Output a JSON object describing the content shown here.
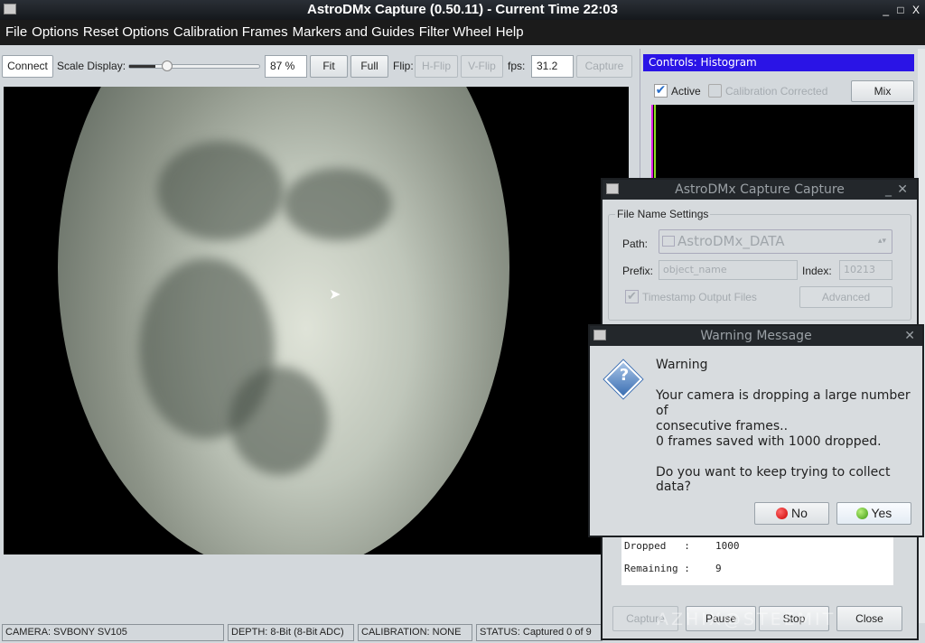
{
  "window": {
    "title": "AstroDMx Capture (0.50.11) - Current Time 22:03",
    "controls": [
      "_",
      "□",
      "X"
    ]
  },
  "menu": [
    "File",
    "Options",
    "Reset Options",
    "Calibration Frames",
    "Markers and Guides",
    "Filter Wheel",
    "Help"
  ],
  "toolbar": {
    "connect": "Connect",
    "scale_label": "Scale Display:",
    "scale_value": "87 %",
    "scale_fraction": 0.2,
    "fit": "Fit",
    "full": "Full",
    "flip_label": "Flip:",
    "hflip": "H-Flip",
    "vflip": "V-Flip",
    "fps_label": "fps:",
    "fps_value": "31.2",
    "capture": "Capture"
  },
  "histogram": {
    "title": "Controls: Histogram",
    "active": "Active",
    "active_checked": true,
    "calibration": "Calibration Corrected",
    "calibration_checked": false,
    "mix": "Mix",
    "accent": "#2a14e6"
  },
  "capture_dialog": {
    "title": "AstroDMx Capture Capture",
    "group": "File Name Settings",
    "path_label": "Path:",
    "path_value": "AstroDMx_DATA",
    "prefix_label": "Prefix:",
    "prefix_placeholder": "object_name",
    "index_label": "Index:",
    "index_value": "10213",
    "timestamp": "Timestamp Output Files",
    "timestamp_checked": true,
    "advanced": "Advanced",
    "dropped_label": "Dropped   :",
    "dropped_value": "1000",
    "remaining_label": "Remaining :",
    "remaining_value": "9",
    "capture": "Capture",
    "pause": "Pause",
    "stop": "Stop",
    "close": "Close"
  },
  "warning": {
    "title": "Warning Message",
    "heading": "Warning",
    "line1": "Your camera is dropping a large number of",
    "line2": "consecutive frames..",
    "line3": "0 frames saved with 1000 dropped.",
    "line4": "Do you want to keep trying to collect data?",
    "no": "No",
    "yes": "Yes"
  },
  "status": {
    "camera": "CAMERA: SVBONY SV105",
    "depth": "DEPTH: 8-Bit (8-Bit ADC)",
    "calibration": "CALIBRATION: NONE",
    "status": "STATUS: Captured 0  of 9"
  },
  "watermark": "AZHIX@STEEMIT"
}
